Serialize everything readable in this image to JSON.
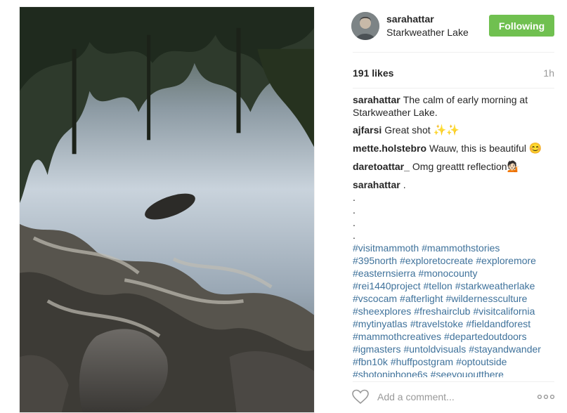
{
  "post": {
    "username": "sarahattar",
    "location": "Starkweather Lake",
    "follow_label": "Following",
    "likes": "191 likes",
    "time": "1h",
    "comment_placeholder": "Add a comment..."
  },
  "caption": {
    "user": "sarahattar",
    "text": "The calm of early morning at Starkweather Lake."
  },
  "comments": [
    {
      "user": "ajfarsi",
      "text": "Great shot",
      "emoji": "✨✨"
    },
    {
      "user": "mette.holstebro",
      "text": "Wauw, this is beautiful",
      "emoji": "😊"
    },
    {
      "user": "daretoattar_",
      "text": "Omg greattt reflection",
      "emoji": "💁🏻"
    }
  ],
  "last_comment": {
    "user": "sarahattar",
    "text": ".",
    "dots": [
      ".",
      ".",
      ".",
      "."
    ],
    "hashtags": [
      [
        "#visitmammoth",
        "#mammothstories"
      ],
      [
        "#395north",
        "#exploretocreate",
        "#exploremore"
      ],
      [
        "#easternsierra",
        "#monocounty"
      ],
      [
        "#rei1440project",
        "#tellon",
        "#starkweatherlake"
      ],
      [
        "#vscocam",
        "#afterlight",
        "#wildernessculture"
      ],
      [
        "#sheexplores",
        "#freshairclub",
        "#visitcalifornia"
      ],
      [
        "#mytinyatlas",
        "#travelstoke",
        "#fieldandforest"
      ],
      [
        "#mammothcreatives",
        "#departedoutdoors"
      ],
      [
        "#igmasters",
        "#untoldvisuals",
        "#stayandwander"
      ],
      [
        "#fbn10k",
        "#huffpostgram",
        "#optoutside"
      ],
      [
        "#shotoniphone6s",
        "#seeyououtthere"
      ]
    ]
  },
  "icons": {
    "heart": "heart-outline-icon",
    "more": "more-options-icon"
  },
  "colors": {
    "follow_button": "#70c050",
    "hashtag": "#3f729b",
    "muted": "#999999"
  }
}
